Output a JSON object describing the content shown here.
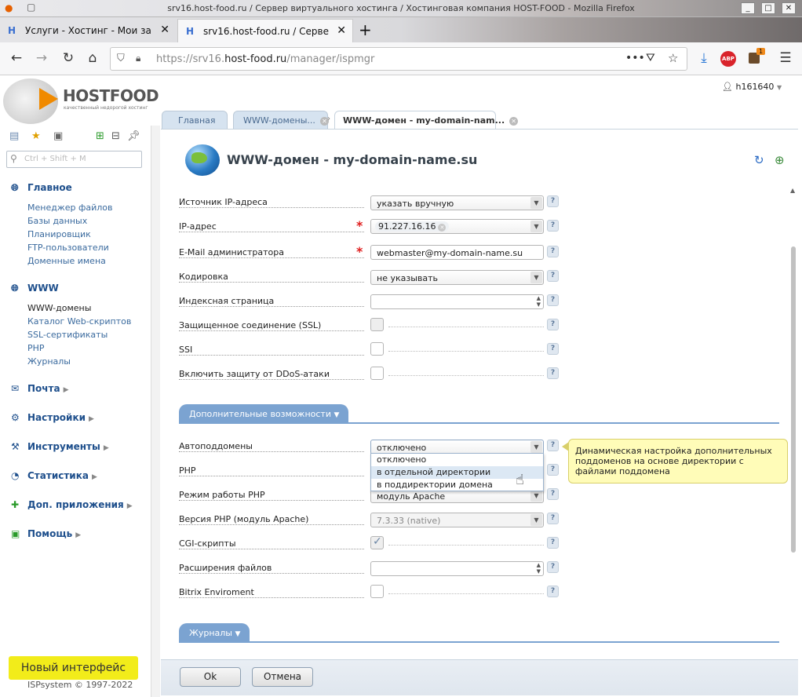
{
  "window": {
    "title": "srv16.host-food.ru / Сервер виртуального хостинга / Хостинговая компания HOST-FOOD - Mozilla Firefox"
  },
  "browser_tabs": [
    {
      "label": "Услуги - Хостинг - Мои за",
      "favicon": "hf-icon"
    },
    {
      "label": "srv16.host-food.ru / Серве",
      "favicon": "hf-icon"
    }
  ],
  "urlbar": {
    "url_prefix": "https://srv16.",
    "url_domain": "host-food.ru",
    "url_path": "/manager/ispmgr"
  },
  "extensions": {
    "abp_label": "ABP",
    "badge_count": "1"
  },
  "user": {
    "name": "h161640"
  },
  "logo": {
    "name": "HOSTFOOD",
    "tagline": "качественный недорогой хостинг"
  },
  "sidebar": {
    "search_placeholder": "Ctrl + Shift + M",
    "sections": [
      {
        "label": "Главное",
        "items": [
          "Менеджер файлов",
          "Базы данных",
          "Планировщик",
          "FTP-пользователи",
          "Доменные имена"
        ]
      },
      {
        "label": "WWW",
        "items": [
          "WWW-домены",
          "Каталог Web-скриптов",
          "SSL-сертификаты",
          "PHP",
          "Журналы"
        ]
      },
      {
        "label": "Почта"
      },
      {
        "label": "Настройки"
      },
      {
        "label": "Инструменты"
      },
      {
        "label": "Статистика"
      },
      {
        "label": "Доп. приложения"
      },
      {
        "label": "Помощь"
      }
    ],
    "new_interface": "Новый интерфейс",
    "copyright": "ISPsystem © 1997-2022"
  },
  "content_tabs": [
    "Главная",
    "WWW-домены...",
    "WWW-домен - my-domain-nam..."
  ],
  "page_title": "WWW-домен - my-domain-name.su",
  "form": {
    "ip_source": {
      "label": "Источник IP-адреса",
      "value": "указать вручную"
    },
    "ip": {
      "label": "IP-адрес",
      "value": "91.227.16.16"
    },
    "email": {
      "label": "E-Mail администратора",
      "value": "webmaster@my-domain-name.su"
    },
    "charset": {
      "label": "Кодировка",
      "value": "не указывать"
    },
    "index": {
      "label": "Индексная страница",
      "value": ""
    },
    "ssl": {
      "label": "Защищенное соединение (SSL)"
    },
    "ssi": {
      "label": "SSI"
    },
    "ddos": {
      "label": "Включить защиту от DDoS-атаки"
    },
    "group_extra": "Дополнительные возможности",
    "autosub": {
      "label": "Автоподдомены",
      "value": "отключено",
      "options": [
        "отключено",
        "в отдельной директории",
        "в поддиректории домена"
      ]
    },
    "php": {
      "label": "PHP"
    },
    "php_mode": {
      "label": "Режим работы PHP",
      "value": "модуль Apache"
    },
    "php_version": {
      "label": "Версия PHP (модуль Apache)",
      "value": "7.3.33 (native)"
    },
    "cgi": {
      "label": "CGI-скрипты"
    },
    "ext": {
      "label": "Расширения файлов",
      "value": ""
    },
    "bitrix": {
      "label": "Bitrix Enviroment"
    },
    "group_logs": "Журналы",
    "tooltip": "Динамическая настройка дополнительных поддоменов на основе директории с файлами поддомена"
  },
  "buttons": {
    "ok": "Ok",
    "cancel": "Отмена"
  }
}
